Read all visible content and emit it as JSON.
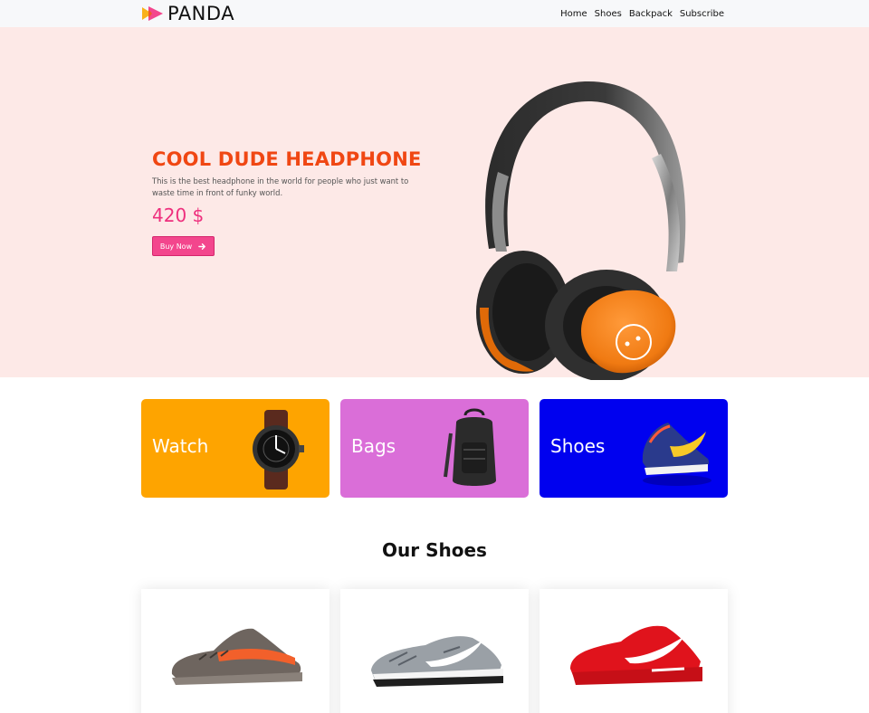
{
  "navbar": {
    "brand": "PANDA",
    "links": [
      {
        "label": "Home"
      },
      {
        "label": "Shoes"
      },
      {
        "label": "Backpack"
      },
      {
        "label": "Subscribe"
      }
    ]
  },
  "hero": {
    "title": "COOL DUDE HEADPHONE",
    "description": "This is the best headphone in the world for people who just want to waste time in front of funky world.",
    "price": "420 $",
    "button_label": "Buy Now"
  },
  "categories": [
    {
      "label": "Watch",
      "icon": "watch-icon",
      "color": "#fea400"
    },
    {
      "label": "Bags",
      "icon": "backpack-icon",
      "color": "#da6ed8"
    },
    {
      "label": "Shoes",
      "icon": "sneaker-icon",
      "color": "#0001ef"
    }
  ],
  "our_shoes": {
    "title": "Our Shoes",
    "items": [
      {
        "icon": "grey-orange-sneaker-icon"
      },
      {
        "icon": "grey-running-shoe-icon"
      },
      {
        "icon": "red-running-shoe-icon"
      }
    ]
  },
  "colors": {
    "accent_orange": "#f04713",
    "accent_pink": "#ee2f7d",
    "hero_background": "#fde9e7"
  }
}
